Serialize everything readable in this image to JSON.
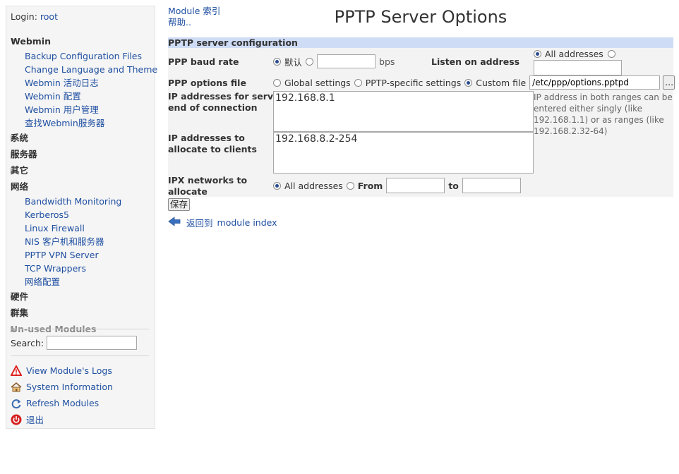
{
  "login": {
    "label": "Login:",
    "user": "root"
  },
  "sidebar": {
    "tree": [
      {
        "type": "cat",
        "label": "Webmin",
        "open": true
      },
      {
        "type": "mod",
        "label": "Backup Configuration Files"
      },
      {
        "type": "mod",
        "label": "Change Language and Theme"
      },
      {
        "type": "mod",
        "label": "Webmin 活动日志"
      },
      {
        "type": "mod",
        "label": "Webmin 配置"
      },
      {
        "type": "mod",
        "label": "Webmin 用户管理"
      },
      {
        "type": "mod",
        "label": "查找Webmin服务器"
      },
      {
        "type": "cat",
        "label": "系统",
        "open": false
      },
      {
        "type": "cat",
        "label": "服务器",
        "open": false
      },
      {
        "type": "cat",
        "label": "其它",
        "open": false
      },
      {
        "type": "cat",
        "label": "网络",
        "open": true
      },
      {
        "type": "mod",
        "label": "Bandwidth Monitoring"
      },
      {
        "type": "mod",
        "label": "Kerberos5"
      },
      {
        "type": "mod",
        "label": "Linux Firewall"
      },
      {
        "type": "mod",
        "label": "NIS 客户机和服务器"
      },
      {
        "type": "mod",
        "label": "PPTP VPN Server"
      },
      {
        "type": "mod",
        "label": "TCP Wrappers"
      },
      {
        "type": "mod",
        "label": "网络配置"
      },
      {
        "type": "cat",
        "label": "硬件",
        "open": false
      },
      {
        "type": "cat",
        "label": "群集",
        "open": false
      },
      {
        "type": "cat",
        "label": "Un-used Modules",
        "open": false,
        "dim": true
      }
    ],
    "search_label": "Search:",
    "tools": [
      {
        "icon": "warning-icon",
        "label": "View Module's Logs"
      },
      {
        "icon": "house-icon",
        "label": "System Information"
      },
      {
        "icon": "refresh-icon",
        "label": "Refresh Modules"
      },
      {
        "icon": "power-icon",
        "label": "退出"
      }
    ]
  },
  "top": {
    "module_index": "Module 索引",
    "help": "帮助.."
  },
  "page": {
    "title": "PPTP Server Options"
  },
  "form": {
    "header": "PPTP server configuration",
    "baud": {
      "label": "PPP baud rate",
      "default_label": "默认",
      "value": "",
      "unit": "bps"
    },
    "listen": {
      "label": "Listen on address",
      "all_label": "All addresses",
      "value": ""
    },
    "options": {
      "label": "PPP options file",
      "global": "Global settings",
      "specific": "PPTP-specific settings",
      "custom": "Custom file",
      "value": "/etc/ppp/options.pptpd",
      "browse": "..."
    },
    "server_ips": {
      "label_1": "IP addresses for server",
      "label_2": "end of connection",
      "value": "192.168.8.1"
    },
    "client_ips": {
      "label_1": "IP addresses to",
      "label_2": "allocate to clients",
      "value": "192.168.8.2-254"
    },
    "note": [
      "IP address in both ranges can be",
      "entered either singly (like",
      "192.168.1.1) or as ranges (like",
      "192.168.2.32-64)"
    ],
    "ipx": {
      "label_1": "IPX networks to",
      "label_2": "allocate",
      "all_label": "All addresses",
      "from_label": "From",
      "to_label": "to",
      "from_value": "",
      "to_value": ""
    },
    "save": "保存"
  },
  "back": {
    "prefix": "返回到",
    "link": "module index"
  }
}
